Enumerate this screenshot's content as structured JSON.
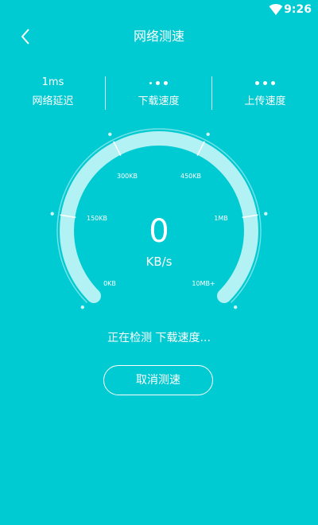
{
  "status_bar": {
    "time": "9:26",
    "wifi_icon": "wifi-icon"
  },
  "toolbar": {
    "back_icon": "chevron-left-icon",
    "title": "网络测速"
  },
  "metrics": {
    "latency": {
      "value": "1ms",
      "label": "网络延迟"
    },
    "download": {
      "value": "...",
      "label": "下载速度"
    },
    "upload": {
      "value": "...",
      "label": "上传速度"
    }
  },
  "gauge": {
    "tick_labels": [
      "0KB",
      "150KB",
      "300KB",
      "450KB",
      "1MB",
      "10MB+"
    ],
    "value": "0",
    "unit": "KB/s",
    "level": 0
  },
  "status_text": "正在检测 下载速度...",
  "cancel_button": "取消测速",
  "colors": {
    "background": "#00CAD2",
    "gauge_track": "#B2F2F4",
    "text": "#FFFFFF"
  }
}
